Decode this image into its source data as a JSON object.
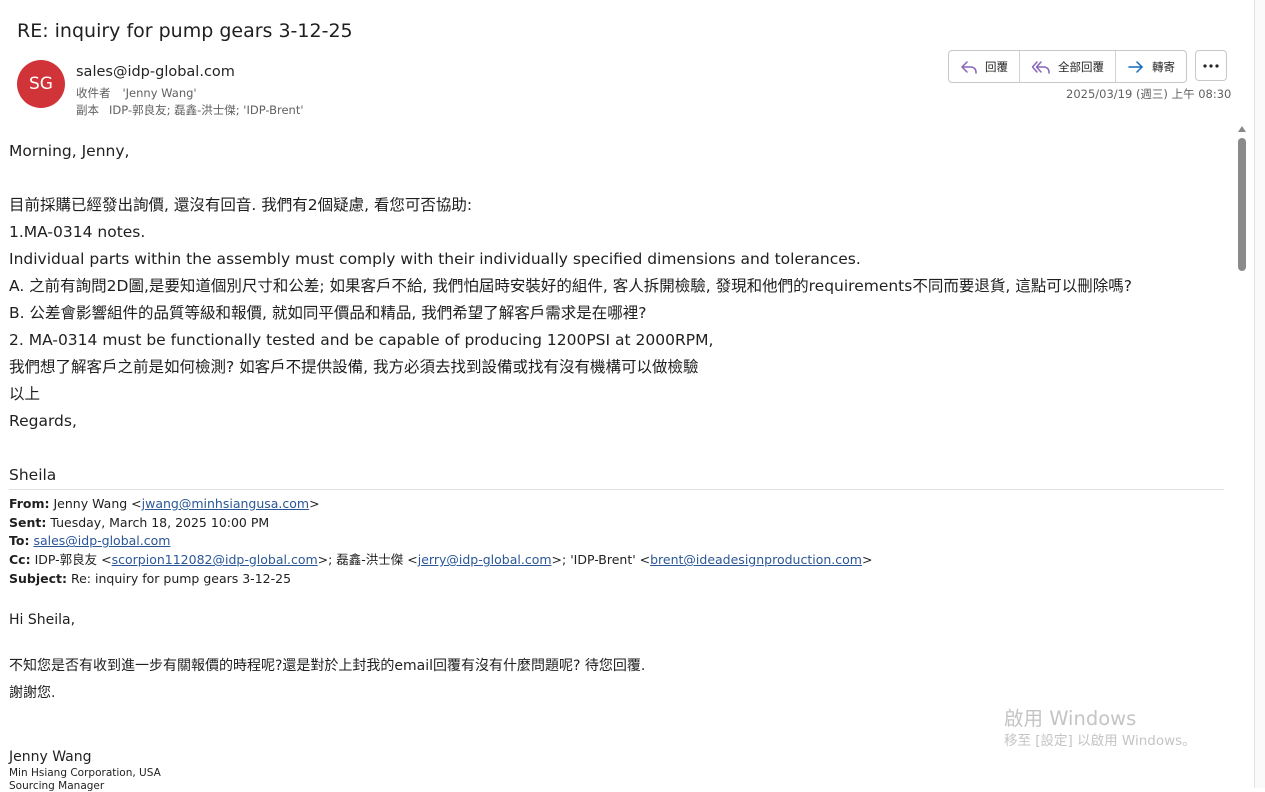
{
  "email": {
    "subject": "RE: inquiry for pump gears 3-12-25",
    "avatar_initials": "SG",
    "avatar_color": "#d13438",
    "sender": "sales@idp-global.com",
    "to_label": "收件者",
    "to_value": "'Jenny Wang'",
    "cc_label": "副本",
    "cc_value": "IDP-郭良友; 磊鑫-洪士傑; 'IDP-Brent'",
    "date": "2025/03/19 (週三) 上午 08:30"
  },
  "actions": {
    "reply": "回覆",
    "reply_all": "全部回覆",
    "forward": "轉寄",
    "reply_icon": "reply-icon",
    "reply_all_icon": "reply-all-icon",
    "forward_icon": "forward-icon",
    "more_icon": "more-options-icon",
    "accent_color": "#8764b8"
  },
  "body": {
    "greeting": "Morning, Jenny,",
    "p1": "目前採購已經發出詢價, 還沒有回音. 我們有2個疑慮, 看您可否協助:",
    "p2": "1.MA-0314 notes.",
    "p3": "Individual parts within the assembly must comply with their individually specified dimensions and tolerances.",
    "p4": "A.  之前有詢問2D圖,是要知道個別尺寸和公差; 如果客戶不給, 我們怕屆時安裝好的組件, 客人拆開檢驗, 發現和他們的requirements不同而要退貨, 這點可以刪除嗎?",
    "p5": "B.  公差會影響組件的品質等級和報價, 就如同平價品和精品, 我們希望了解客戶需求是在哪裡?",
    "p6": "2. MA-0314 must be functionally tested and be capable of producing 1200PSI at 2000RPM,",
    "p7": "我們想了解客戶之前是如何檢測? 如客戶不提供設備, 我方必須去找到設備或找有沒有機構可以做檢驗",
    "p8": "以上",
    "p9": "Regards,",
    "signature": "Sheila"
  },
  "quoted": {
    "from_label": "From:",
    "from_name": "Jenny Wang <",
    "from_email": "jwang@minhsiangusa.com",
    "from_end": ">",
    "sent_label": "Sent:",
    "sent_value": "Tuesday, March 18, 2025 10:00 PM",
    "to_label": "To:",
    "to_email": "sales@idp-global.com",
    "cc_label": "Cc:",
    "cc_name1": "IDP-郭良友 <",
    "cc_email1": "scorpion112082@idp-global.com",
    "cc_name2": ">; 磊鑫-洪士傑 <",
    "cc_email2": "jerry@idp-global.com",
    "cc_name3": ">; 'IDP-Brent' <",
    "cc_email3": "brent@ideadesignproduction.com",
    "cc_end": ">",
    "subject_label": "Subject:",
    "subject_value": "Re: inquiry for pump gears 3-12-25",
    "greeting": "Hi Sheila,",
    "line1": "不知您是否有收到進一步有關報價的時程呢?還是對於上封我的email回覆有沒有什麼問題呢? 待您回覆.",
    "line2": "謝謝您.",
    "sig_name": "Jenny Wang",
    "sig_company": "Min Hsiang Corporation, USA",
    "sig_title": "Sourcing Manager"
  },
  "watermark": {
    "title": "啟用 Windows",
    "subtitle": "移至 [設定] 以啟用 Windows。"
  }
}
